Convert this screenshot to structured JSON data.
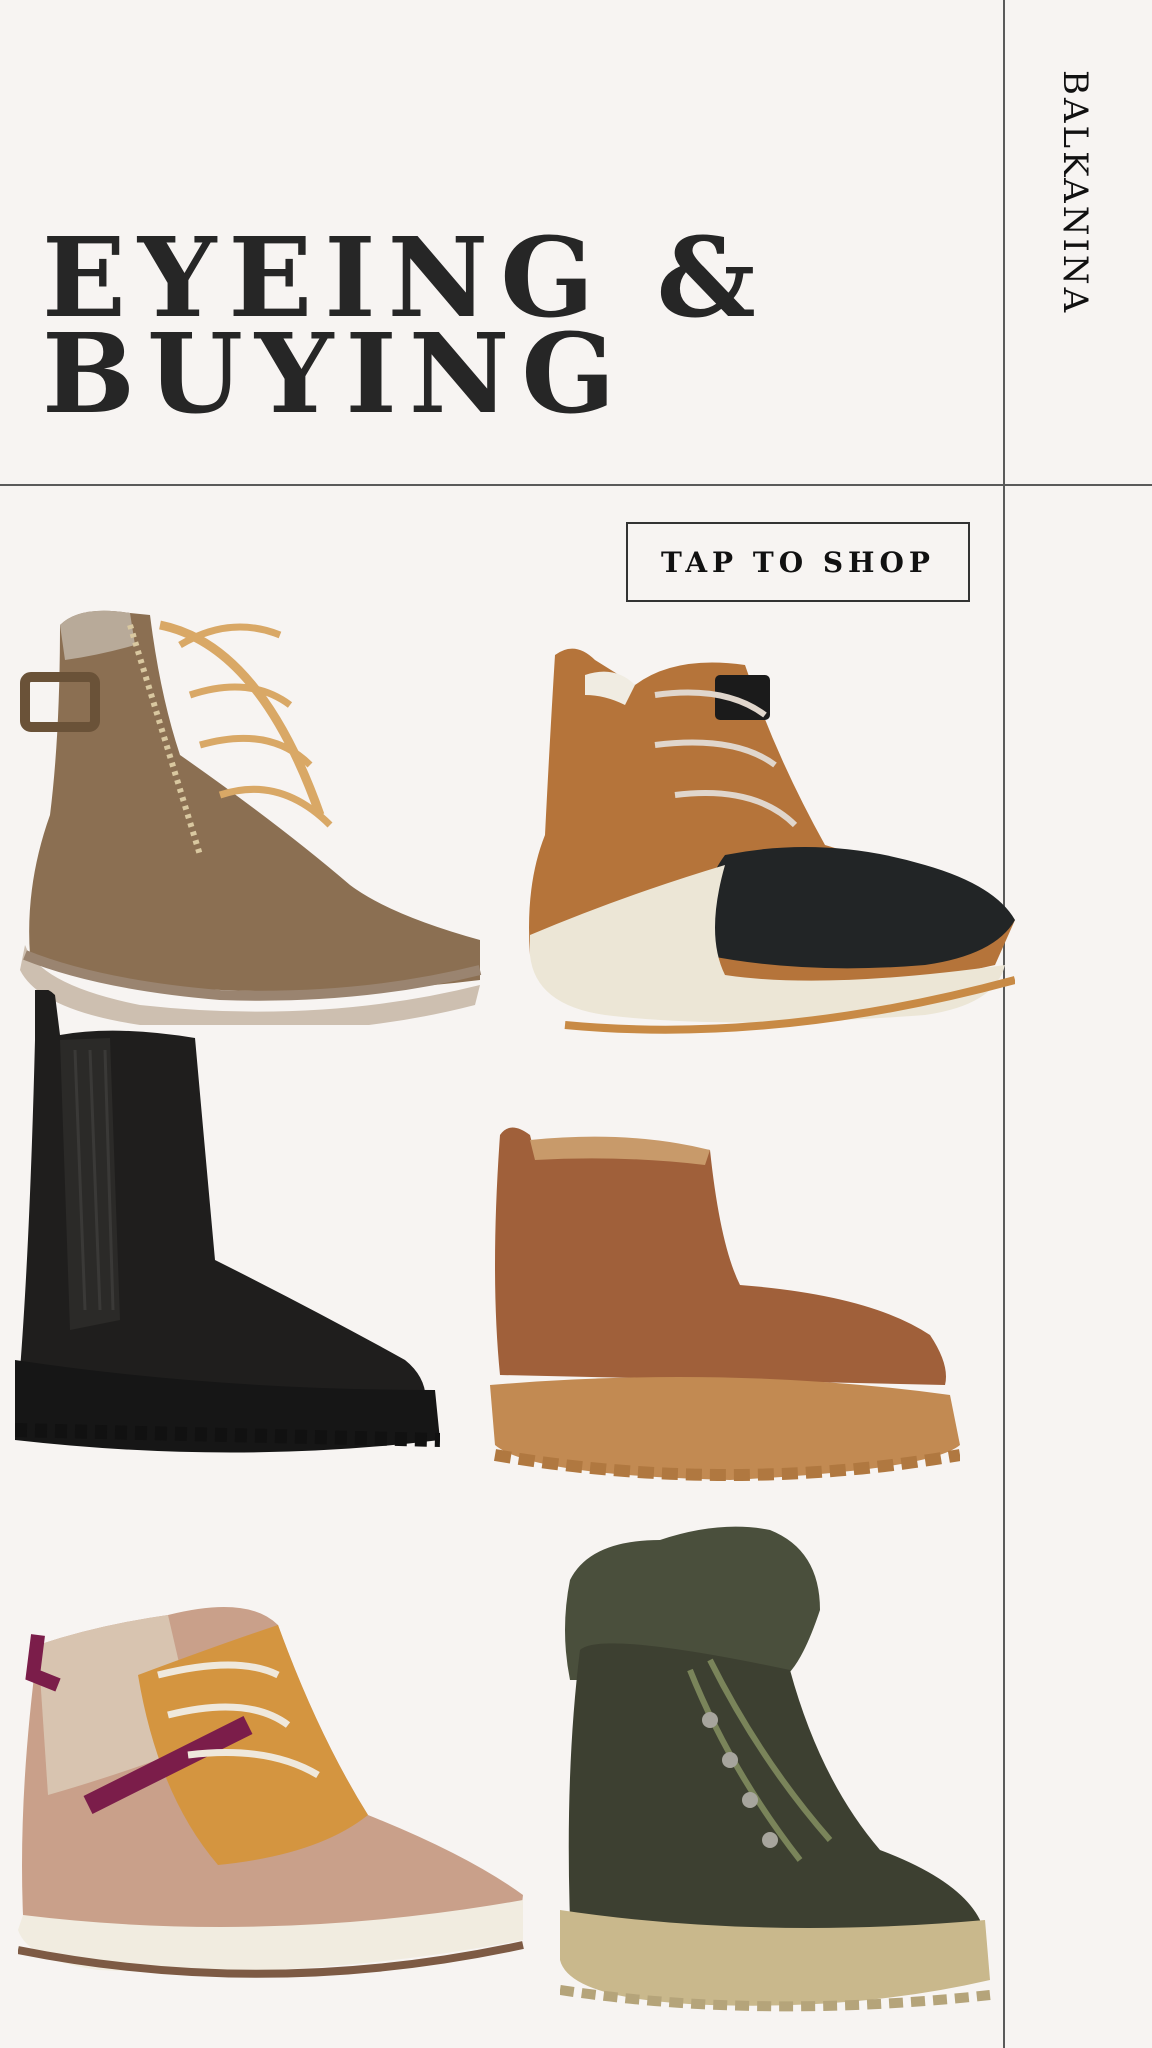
{
  "header": {
    "brand": "BALKANINA",
    "title_line1": "EYEING &",
    "title_line2": "BUYING"
  },
  "cta": {
    "label": "TAP TO SHOP"
  },
  "products": [
    {
      "icon": "tan-lace-up-zip-boot-image"
    },
    {
      "icon": "sorel-duck-boot-image"
    },
    {
      "icon": "black-leather-chelsea-boot-image"
    },
    {
      "icon": "chestnut-platform-slipper-boot-image"
    },
    {
      "icon": "teva-quilted-sneaker-boot-image"
    },
    {
      "icon": "olive-puffer-hiker-boot-image"
    }
  ],
  "colors": {
    "background": "#f7f4f2",
    "rule": "#5a5a5a",
    "title": "#262626"
  }
}
